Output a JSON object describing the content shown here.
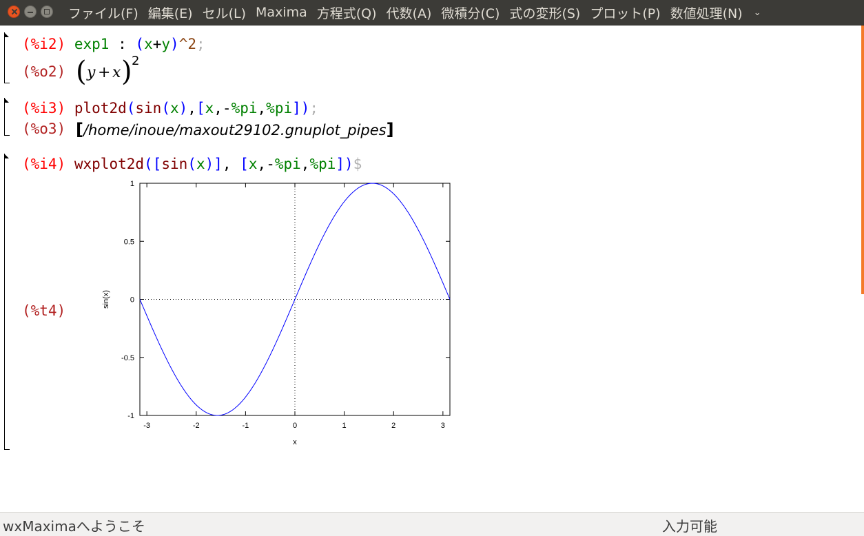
{
  "menubar": {
    "items": [
      "ファイル(F)",
      "編集(E)",
      "セル(L)",
      "Maxima",
      "方程式(Q)",
      "代数(A)",
      "微積分(C)",
      "式の変形(S)",
      "プロット(P)",
      "数値処理(N)"
    ],
    "overflow_icon": "chevron-down-icon"
  },
  "cells": {
    "c1": {
      "in_label": "(%i2)",
      "in_name": "exp1",
      "in_colon": ":",
      "in_open": "(",
      "in_x": "x",
      "in_plus": "+",
      "in_y": "y",
      "in_close": ")",
      "in_pow": "^2",
      "in_term": ";",
      "out_label": "(%o2)",
      "out_lparen": "(",
      "out_y": "y",
      "out_plus": "+",
      "out_x": "x",
      "out_rparen": ")",
      "out_exp": "2"
    },
    "c2": {
      "in_label": "(%i3)",
      "in_fn": "plot2d",
      "in_p1": "(",
      "in_sin": "sin",
      "in_p2": "(",
      "in_x": "x",
      "in_p3": ")",
      "in_comma1": ",",
      "in_lb": "[",
      "in_x2": "x",
      "in_comma2": ",",
      "in_minus": "-",
      "in_pi1": "%pi",
      "in_comma3": ",",
      "in_pi2": "%pi",
      "in_rb": "]",
      "in_p4": ")",
      "in_term": ";",
      "out_label": "(%o3)",
      "out_lbr": "[",
      "out_path": "/home/inoue/maxout29102.gnuplot_pipes",
      "out_rbr": "]"
    },
    "c3": {
      "in_label": "(%i4)",
      "in_fn": "wxplot2d",
      "in_p1": "(",
      "in_lb1": "[",
      "in_sin": "sin",
      "in_p2": "(",
      "in_x": "x",
      "in_p3": ")",
      "in_rb1": "]",
      "in_comma1": ",",
      "in_lb2": "[",
      "in_x2": "x",
      "in_comma2": ",",
      "in_minus": "-",
      "in_pi1": "%pi",
      "in_comma3": ",",
      "in_pi2": "%pi",
      "in_rb2": "]",
      "in_p4": ")",
      "in_term": "$",
      "out_label": "(%t4)"
    }
  },
  "chart_data": {
    "type": "line",
    "title": "",
    "xlabel": "x",
    "ylabel": "sin(x)",
    "xlim": [
      -3.14159,
      3.14159
    ],
    "ylim": [
      -1,
      1
    ],
    "x_ticks": [
      "-3",
      "-2",
      "-1",
      "0",
      "1",
      "2",
      "3"
    ],
    "x_tick_values": [
      -3,
      -2,
      -1,
      0,
      1,
      2,
      3
    ],
    "y_ticks": [
      "1",
      "0.5",
      "0",
      "-0.5",
      "-1"
    ],
    "y_tick_values": [
      1,
      0.5,
      0,
      -0.5,
      -1
    ],
    "grid": false,
    "zero_axes": "dotted",
    "series": [
      {
        "function": "sin(x)",
        "color": "#0000ff",
        "x": [
          -3.14159,
          -2.5,
          -2.0,
          -1.5708,
          -1.0,
          -0.5,
          0,
          0.5,
          1.0,
          1.5708,
          2.0,
          2.5,
          3.14159
        ],
        "y": [
          0,
          -0.598,
          -0.909,
          -1.0,
          -0.841,
          -0.479,
          0,
          0.479,
          0.841,
          1.0,
          0.909,
          0.598,
          0
        ]
      }
    ]
  },
  "statusbar": {
    "left_text": "wxMaximaへようこそ",
    "right_text": "入力可能"
  },
  "colors": {
    "menubar_bg": "#3c3b37",
    "close_button": "#e95420",
    "input_label": "#ff0000",
    "output_label": "#b22222",
    "plot_line": "#0000ff",
    "scroll_marker": "#f47a2a"
  }
}
